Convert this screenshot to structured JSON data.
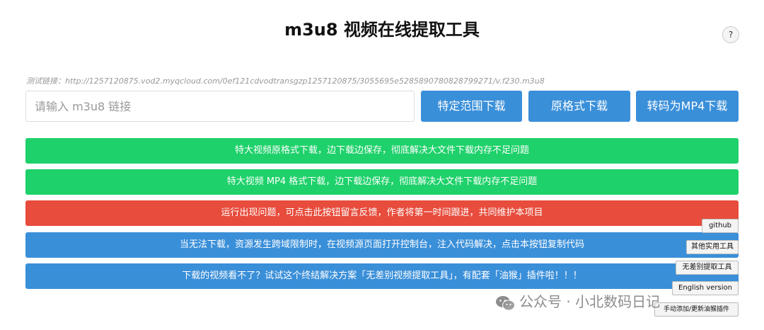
{
  "header": {
    "title": "m3u8 视频在线提取工具",
    "help_label": "?"
  },
  "test_link": "测试链接：http://1257120875.vod2.myqcloud.com/0ef121cdvodtransgzp1257120875/3055695e5285890780828799271/v.f230.m3u8",
  "search": {
    "value": "",
    "placeholder": "请输入 m3u8 链接"
  },
  "buttons": {
    "range_download": "特定范围下载",
    "original_download": "原格式下载",
    "convert_mp4": "转码为MP4下载"
  },
  "bars": [
    "特大视频原格式下载，边下载边保存，彻底解决大文件下载内存不足问题",
    "特大视频 MP4 格式下载，边下载边保存，彻底解决大文件下载内存不足问题",
    "运行出现问题，可点击此按钮留言反馈，作者将第一时间跟进，共同维护本项目",
    "当无法下载，资源发生跨域限制时，在视频源页面打开控制台，注入代码解决，点击本按钮复制代码",
    "下载的视频看不了？试试这个终结解决方案「无差别视频提取工具」，有配套「油猴」插件啦！！！"
  ],
  "side_buttons": {
    "github": "github",
    "other_tools": "其他实用工具",
    "no_diff_tool": "无差别提取工具",
    "english": "English version",
    "manual_add": "手动添加/更新油猴插件"
  },
  "watermark": {
    "text": "公众号 · 小北数码日记",
    "icon": "wechat-icon"
  },
  "colors": {
    "primary_blue": "#3a8fd9",
    "green": "#1ed16a",
    "red": "#e74c3c"
  }
}
